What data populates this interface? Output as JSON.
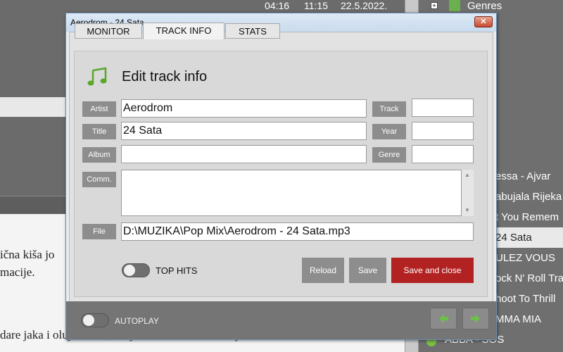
{
  "background": {
    "clock": {
      "time1": "04:16",
      "time2": "11:15",
      "date": "22.5.2022."
    },
    "doc_lines": [
      "ična kiša jo",
      "macije.",
      "dare jaka i olujna bura, dahju na moru silo do olujnch"
    ],
    "genres_label": "Genres",
    "playlist": [
      "essa - Ajvar",
      "abujala Rijeka",
      "t You Remem",
      "24 Sata",
      "ULEZ VOUS",
      "ock N' Roll Tra",
      "hoot To Thrill",
      "MMA MIA",
      "ABBA - SOS"
    ]
  },
  "dialog": {
    "title": "Aerodrom - 24 Sata",
    "close_glyph": "✕",
    "tabs": [
      "MONITOR",
      "TRACK INFO",
      "STATS"
    ],
    "active_tab": "TRACK INFO",
    "heading": "Edit track info",
    "labels": {
      "artist": "Artist",
      "title": "Title",
      "album": "Album",
      "comment": "Comm.",
      "file": "File",
      "track": "Track",
      "year": "Year",
      "genre": "Genre"
    },
    "values": {
      "artist": "Aerodrom",
      "title": "24 Sata",
      "album": "",
      "comment": "",
      "file": "D:\\MUZIKA\\Pop Mix\\Aerodrom - 24 Sata.mp3",
      "track": "",
      "year": "",
      "genre": ""
    },
    "top_hits_label": "TOP HITS",
    "buttons": {
      "reload": "Reload",
      "save": "Save",
      "save_close": "Save and close"
    },
    "autoplay_label": "AUTOPLAY",
    "colors": {
      "accent_red": "#b22222",
      "green_icon": "#5aa62a"
    }
  }
}
